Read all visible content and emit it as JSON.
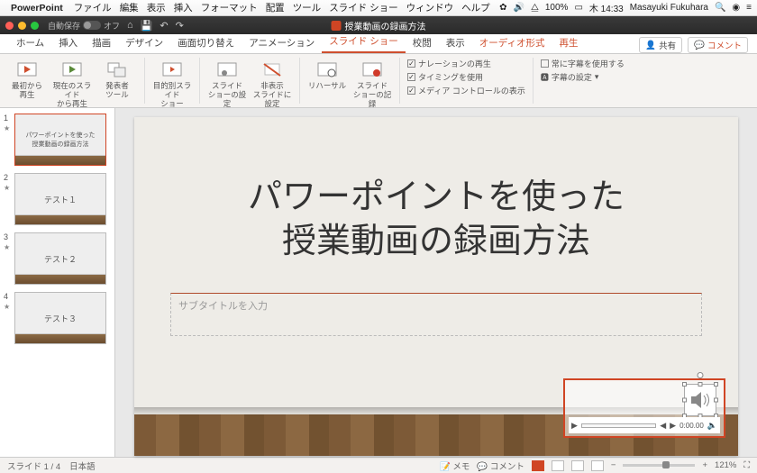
{
  "menubar": {
    "app": "PowerPoint",
    "items": [
      "ファイル",
      "編集",
      "表示",
      "挿入",
      "フォーマット",
      "配置",
      "ツール",
      "スライド ショー",
      "ウィンドウ",
      "ヘルプ"
    ],
    "battery": "100%",
    "clock": "木 14:33",
    "user": "Masayuki Fukuhara"
  },
  "titlebar": {
    "autosave_label": "自動保存",
    "autosave_state": "オフ",
    "doc": "授業動画の録画方法"
  },
  "tabs": {
    "items": [
      "ホーム",
      "挿入",
      "描画",
      "デザイン",
      "画面切り替え",
      "アニメーション",
      "スライド ショー",
      "校閲",
      "表示",
      "オーディオ形式",
      "再生"
    ],
    "active": "スライド ショー",
    "share": "共有",
    "comment": "コメント"
  },
  "ribbon": {
    "btn1": "最初から\n再生",
    "btn2": "現在のスライド\nから再生",
    "btn3": "発表者\nツール",
    "btn4": "目的別スライド\nショー",
    "btn5": "スライド\nショーの設定",
    "btn6": "非表示\nスライドに設定",
    "btn7": "リハーサル",
    "btn8": "スライド\nショーの記録",
    "chk1": "ナレーションの再生",
    "chk2": "タイミングを使用",
    "chk3": "メディア コントロールの表示",
    "chk4": "常に字幕を使用する",
    "subset": "字幕の設定"
  },
  "thumbs": [
    {
      "n": "1",
      "line1": "パワーポイントを使った",
      "line2": "授業動画の録画方法",
      "sel": true
    },
    {
      "n": "2",
      "line1": "テスト１",
      "line2": ""
    },
    {
      "n": "3",
      "line1": "テスト２",
      "line2": ""
    },
    {
      "n": "4",
      "line1": "テスト３",
      "line2": ""
    }
  ],
  "slide": {
    "title_l1": "パワーポイントを使った",
    "title_l2": "授業動画の録画方法",
    "subtitle_ph": "サブタイトルを入力"
  },
  "audio": {
    "time": "0:00.00"
  },
  "status": {
    "pos": "スライド 1 / 4",
    "lang": "日本語",
    "notes": "メモ",
    "comments": "コメント",
    "zoom": "121%"
  }
}
